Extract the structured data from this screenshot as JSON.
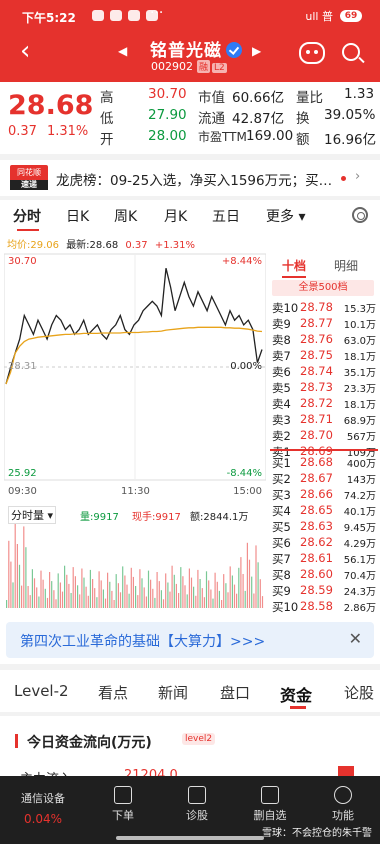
{
  "status": {
    "time": "下午5:22",
    "dots": "···",
    "signal": "ull 普",
    "battery": "69"
  },
  "header": {
    "back": "‹",
    "prev": "◀",
    "next": "▶",
    "title": "铭普光磁",
    "code": "002902",
    "badge_rz": "融",
    "badge_l2": "L2"
  },
  "quote": {
    "price": "28.68",
    "change": "0.37",
    "change_pct": "1.31%",
    "rows": [
      {
        "k1": "高",
        "v1": "30.70",
        "k2": "市值",
        "v2": "60.66亿",
        "k3": "量比",
        "v3": "1.33"
      },
      {
        "k1": "低",
        "v1": "27.90",
        "k2": "流通",
        "v2": "42.87亿",
        "k3": "换",
        "v3": "39.05%"
      },
      {
        "k1": "开",
        "v1": "28.00",
        "k2": "市盈TTM",
        "v2": "169.00",
        "k3": "额",
        "v3": "16.96亿"
      }
    ]
  },
  "news": {
    "logo_top": "同花顺",
    "logo_bottom": "速递",
    "text": "龙虎榜：09-25入选，净买入1596万元；买…",
    "chevron": "›"
  },
  "period_tabs": [
    "分时",
    "日K",
    "周K",
    "月K",
    "五日",
    "更多 ▾"
  ],
  "legend": {
    "avg": "均价:29.06",
    "latest": "最新:28.68",
    "chg": "0.37",
    "pct": "+1.31%"
  },
  "chart_labels": {
    "top_price": "30.70",
    "top_pct": "+8.44%",
    "bottom_price": "25.92",
    "bottom_pct": "-8.44%",
    "mid_pct": "0.00%",
    "mid_price": "28.31",
    "time_start": "09:30",
    "time_mid": "11:30",
    "time_end": "15:00",
    "vol_tab": "分时量 ▾",
    "vol_amount": "量:9917",
    "hand": "现手:9917",
    "turnover": "额:2844.1万"
  },
  "chart_data": {
    "type": "line",
    "ylim": [
      25.92,
      30.7
    ],
    "series": [
      {
        "values": [
          27.95,
          28.3,
          28.6,
          28.9,
          29.4,
          29.2,
          29.0,
          29.3,
          29.1,
          28.9,
          29.2,
          29.4,
          29.3,
          29.1,
          29.2,
          29.0,
          29.1,
          29.3,
          29.0,
          29.1,
          29.2,
          29.0,
          28.9,
          29.1,
          29.2,
          29.4,
          29.1,
          29.0,
          29.2,
          29.3,
          29.5,
          29.6,
          29.7,
          29.6,
          29.4,
          30.4,
          30.0,
          29.5,
          29.8,
          30.1,
          29.8,
          29.6,
          29.9,
          29.7,
          29.5,
          29.8,
          29.6,
          29.4,
          29.2,
          29.5,
          29.3,
          29.4,
          29.2,
          29.3,
          29.1,
          28.4,
          28.68
        ]
      },
      {
        "values": [
          27.95,
          28.2,
          28.6,
          28.75,
          28.85,
          28.9,
          28.92,
          28.94,
          28.95,
          28.96,
          28.97,
          28.98,
          28.99,
          29.0,
          29.0,
          29.01,
          29.01,
          29.02,
          29.02,
          29.02,
          29.02,
          29.03,
          29.03,
          29.03,
          29.03,
          29.03,
          29.04,
          29.04,
          29.04,
          29.04,
          29.05,
          29.05,
          29.06,
          29.06,
          29.07,
          29.09,
          29.1,
          29.11,
          29.12,
          29.13,
          29.14,
          29.14,
          29.15,
          29.15,
          29.15,
          29.15,
          29.15,
          29.15,
          29.14,
          29.14,
          29.13,
          29.13,
          29.12,
          29.11,
          29.09,
          29.07,
          29.06
        ]
      }
    ]
  },
  "book": {
    "tab_active": "十档",
    "tab_other": "明细",
    "full": "全景500档",
    "asks": [
      {
        "l": "卖10",
        "p": "28.78",
        "v": "15.3万"
      },
      {
        "l": "卖9",
        "p": "28.77",
        "v": "10.1万"
      },
      {
        "l": "卖8",
        "p": "28.76",
        "v": "63.0万"
      },
      {
        "l": "卖7",
        "p": "28.75",
        "v": "18.1万"
      },
      {
        "l": "卖6",
        "p": "28.74",
        "v": "35.1万"
      },
      {
        "l": "卖5",
        "p": "28.73",
        "v": "23.3万"
      },
      {
        "l": "卖4",
        "p": "28.72",
        "v": "18.1万"
      },
      {
        "l": "卖3",
        "p": "28.71",
        "v": "68.9万"
      },
      {
        "l": "卖2",
        "p": "28.70",
        "v": "567万"
      },
      {
        "l": "卖1",
        "p": "28.69",
        "v": "109万"
      }
    ],
    "bids": [
      {
        "l": "买1",
        "p": "28.68",
        "v": "400万"
      },
      {
        "l": "买2",
        "p": "28.67",
        "v": "143万"
      },
      {
        "l": "买3",
        "p": "28.66",
        "v": "74.2万"
      },
      {
        "l": "买4",
        "p": "28.65",
        "v": "40.1万"
      },
      {
        "l": "买5",
        "p": "28.63",
        "v": "9.45万"
      },
      {
        "l": "买6",
        "p": "28.62",
        "v": "4.29万"
      },
      {
        "l": "买7",
        "p": "28.61",
        "v": "56.1万"
      },
      {
        "l": "买8",
        "p": "28.60",
        "v": "70.4万"
      },
      {
        "l": "买9",
        "p": "28.59",
        "v": "24.3万"
      },
      {
        "l": "买10",
        "p": "28.58",
        "v": "2.86万"
      }
    ]
  },
  "promo": {
    "text": "第四次工业革命的基础【大算力】>>>",
    "close": "✕"
  },
  "content_tabs": [
    "Level-2",
    "看点",
    "新闻",
    "盘口",
    "资金",
    "论股"
  ],
  "fund": {
    "title": "今日资金流向(万元)",
    "tag": "level2",
    "row_label": "主力流入",
    "row_value": "21204.0"
  },
  "bottom_nav": {
    "first_label": "通信设备",
    "first_value": "0.04%",
    "items": [
      "下单",
      "诊股",
      "删自选",
      "功能"
    ],
    "watermark": "雪球：不会控仓的朱千警"
  },
  "colors": {
    "up": "#e5322d",
    "down": "#0c9a3f",
    "avg": "#e8a31a",
    "header": "#e5322d"
  }
}
